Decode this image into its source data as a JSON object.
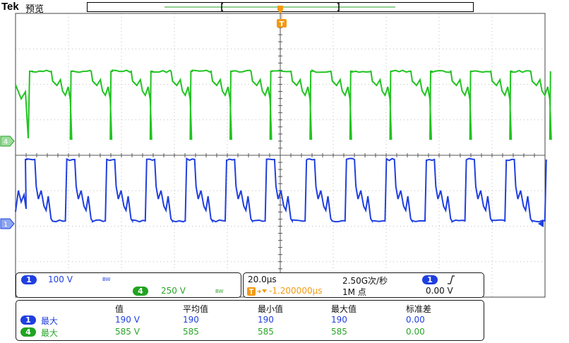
{
  "header": {
    "brand": "Tek",
    "mode": "预览"
  },
  "trigger_marker": "T",
  "channels": {
    "ch4": {
      "number": "4",
      "color": "#21a321",
      "scale": "250 V",
      "bw": "BW"
    },
    "ch1": {
      "number": "1",
      "color": "#1f3fe0",
      "scale": "100 V",
      "bw": "BW"
    }
  },
  "timebase": {
    "horizontal_scale": "20.0μs",
    "sample_rate": "2.50G次/秒",
    "trigger_delay": "-1.200000μs",
    "record_length": "1M 点",
    "trigger_source": "1",
    "trigger_slope_icon": "rising-edge-icon",
    "trigger_level": "0.00 V"
  },
  "measurements": {
    "headers": [
      "值",
      "平均值",
      "最小值",
      "最大值",
      "标准差"
    ],
    "rows": [
      {
        "channel": "1",
        "label": "最大",
        "values": [
          "190 V",
          "190",
          "190",
          "190",
          "0.00"
        ]
      },
      {
        "channel": "4",
        "label": "最大",
        "values": [
          "585 V",
          "585",
          "585",
          "585",
          "0.00"
        ]
      }
    ]
  }
}
